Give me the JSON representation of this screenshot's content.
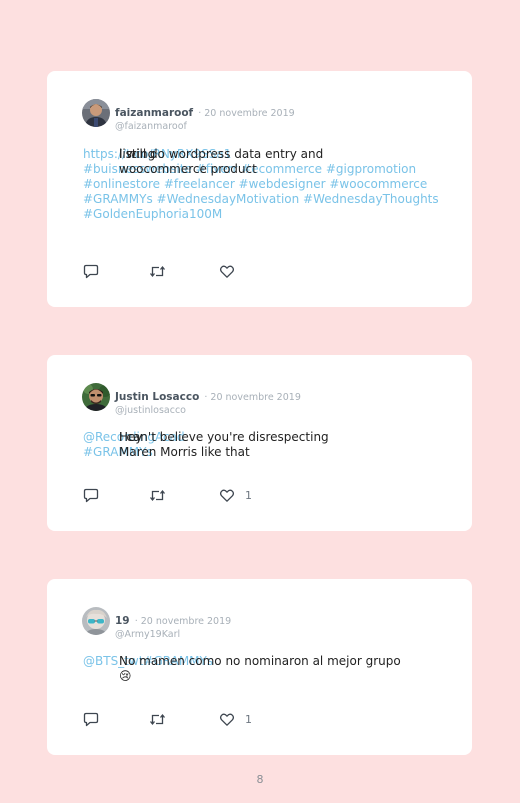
{
  "tweets": [
    {
      "name": "faizanmaroof",
      "date": "· 20 novembre 2019",
      "handle": "@faizanmaroof",
      "lines": [
        [
          {
            "t": "I will do wordpress data entry and woocommerce product",
            "k": "text"
          }
        ],
        [
          {
            "t": "listing ",
            "k": "text"
          },
          {
            "t": "https://t.co/RNyRX9SSa1",
            "k": "link"
          }
        ],
        [
          {
            "t": "#buisnesswebsite #fiverr #ecommerce #gigpromotion",
            "k": "tag"
          }
        ],
        [
          {
            "t": "#onlinestore #freelancer #webdesigner #woocommerce",
            "k": "tag"
          }
        ],
        [
          {
            "t": "#GRAMMYs #WednesdayMotivation #WednesdayThoughts",
            "k": "tag"
          }
        ],
        [
          {
            "t": "#GoldenEuphoria100M",
            "k": "tag"
          }
        ]
      ],
      "likes": ""
    },
    {
      "name": "Justin Losacco",
      "date": "· 20 novembre 2019",
      "handle": "@justinlosacco",
      "lines": [
        [
          {
            "t": "Hey ",
            "k": "text"
          },
          {
            "t": "@RecordingAcad",
            "k": "link"
          },
          {
            "t": " I can't believe you're disrespecting",
            "k": "text"
          }
        ],
        [
          {
            "t": "Maren Morris like that ",
            "k": "text"
          },
          {
            "t": "#GRAMMYs",
            "k": "tag"
          }
        ]
      ],
      "likes": "1"
    },
    {
      "name": "19",
      "date": "· 20 novembre 2019",
      "handle": "@Army19Karl",
      "lines": [
        [
          {
            "t": "No mamen como no nominaron al mejor grupo 😢",
            "k": "text"
          }
        ],
        [
          {
            "t": "@BTS_twt",
            "k": "link"
          },
          {
            "t": " ",
            "k": "text"
          },
          {
            "t": "#GRAMMYs",
            "k": "tag"
          }
        ]
      ],
      "likes": "1"
    }
  ],
  "page_number": "8",
  "colors": {
    "background": "#fde0e0",
    "card": "#ffffff",
    "link": "#7ac3e8",
    "text": "#222222",
    "muted": "#a8b0b8"
  },
  "icons": [
    "reply-icon",
    "retweet-icon",
    "like-icon"
  ]
}
